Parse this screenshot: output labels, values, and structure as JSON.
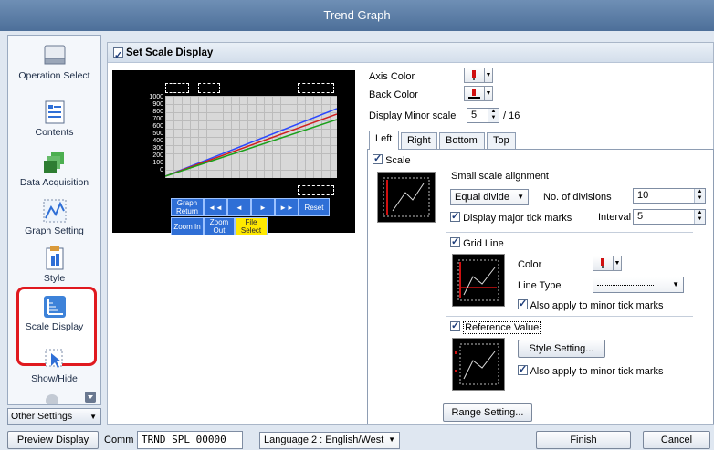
{
  "window": {
    "title": "Trend Graph"
  },
  "sidebar": {
    "items": [
      {
        "label": "Operation Select",
        "icon": "operation-select-icon"
      },
      {
        "label": "Contents",
        "icon": "contents-icon"
      },
      {
        "label": "Data Acquisition",
        "icon": "data-acquisition-icon"
      },
      {
        "label": "Graph Setting",
        "icon": "graph-setting-icon"
      },
      {
        "label": "Style",
        "icon": "style-icon"
      },
      {
        "label": "Scale Display",
        "icon": "scale-display-icon",
        "selected": true
      },
      {
        "label": "Show/Hide",
        "icon": "show-hide-icon"
      }
    ],
    "other_settings": "Other Settings"
  },
  "main": {
    "set_scale_display": "Set Scale Display",
    "preview": {
      "y_ticks": [
        "1000",
        "900",
        "800",
        "700",
        "600",
        "500",
        "400",
        "300",
        "200",
        "100",
        "0"
      ],
      "buttons_row1": [
        "Graph Return",
        "◄◄",
        "◄",
        "►",
        "►►",
        "Reset"
      ],
      "buttons_row2": [
        "Zoom In",
        "Zoom Out",
        "File Select"
      ]
    },
    "axis_color_label": "Axis Color",
    "back_color_label": "Back Color",
    "display_minor_scale_label": "Display Minor scale",
    "minor_scale_value": "5",
    "minor_scale_max": "/ 16",
    "tabs": [
      "Left",
      "Right",
      "Bottom",
      "Top"
    ],
    "scale": {
      "label": "Scale",
      "small_scale_alignment": "Small scale alignment",
      "alignment_value": "Equal divide",
      "no_of_divisions_label": "No. of divisions",
      "no_of_divisions_value": "10",
      "display_major_tick_marks": "Display major tick marks",
      "interval_label": "Interval",
      "interval_value": "5"
    },
    "grid_line": {
      "label": "Grid Line",
      "color_label": "Color",
      "line_type_label": "Line Type",
      "also_apply": "Also apply to minor tick marks"
    },
    "reference_value": {
      "label": "Reference Value",
      "style_setting": "Style Setting...",
      "also_apply": "Also apply to minor tick marks"
    },
    "range_setting": "Range Setting..."
  },
  "footer": {
    "preview_display": "Preview Display",
    "comm_label": "Comm",
    "comm_value": "TRND_SPL_00000",
    "language": "Language 2 : English/West",
    "finish": "Finish",
    "cancel": "Cancel"
  },
  "colors": {
    "accent": "#2f6fd6",
    "highlight": "#e0191f",
    "marker_red": "#d01010"
  }
}
